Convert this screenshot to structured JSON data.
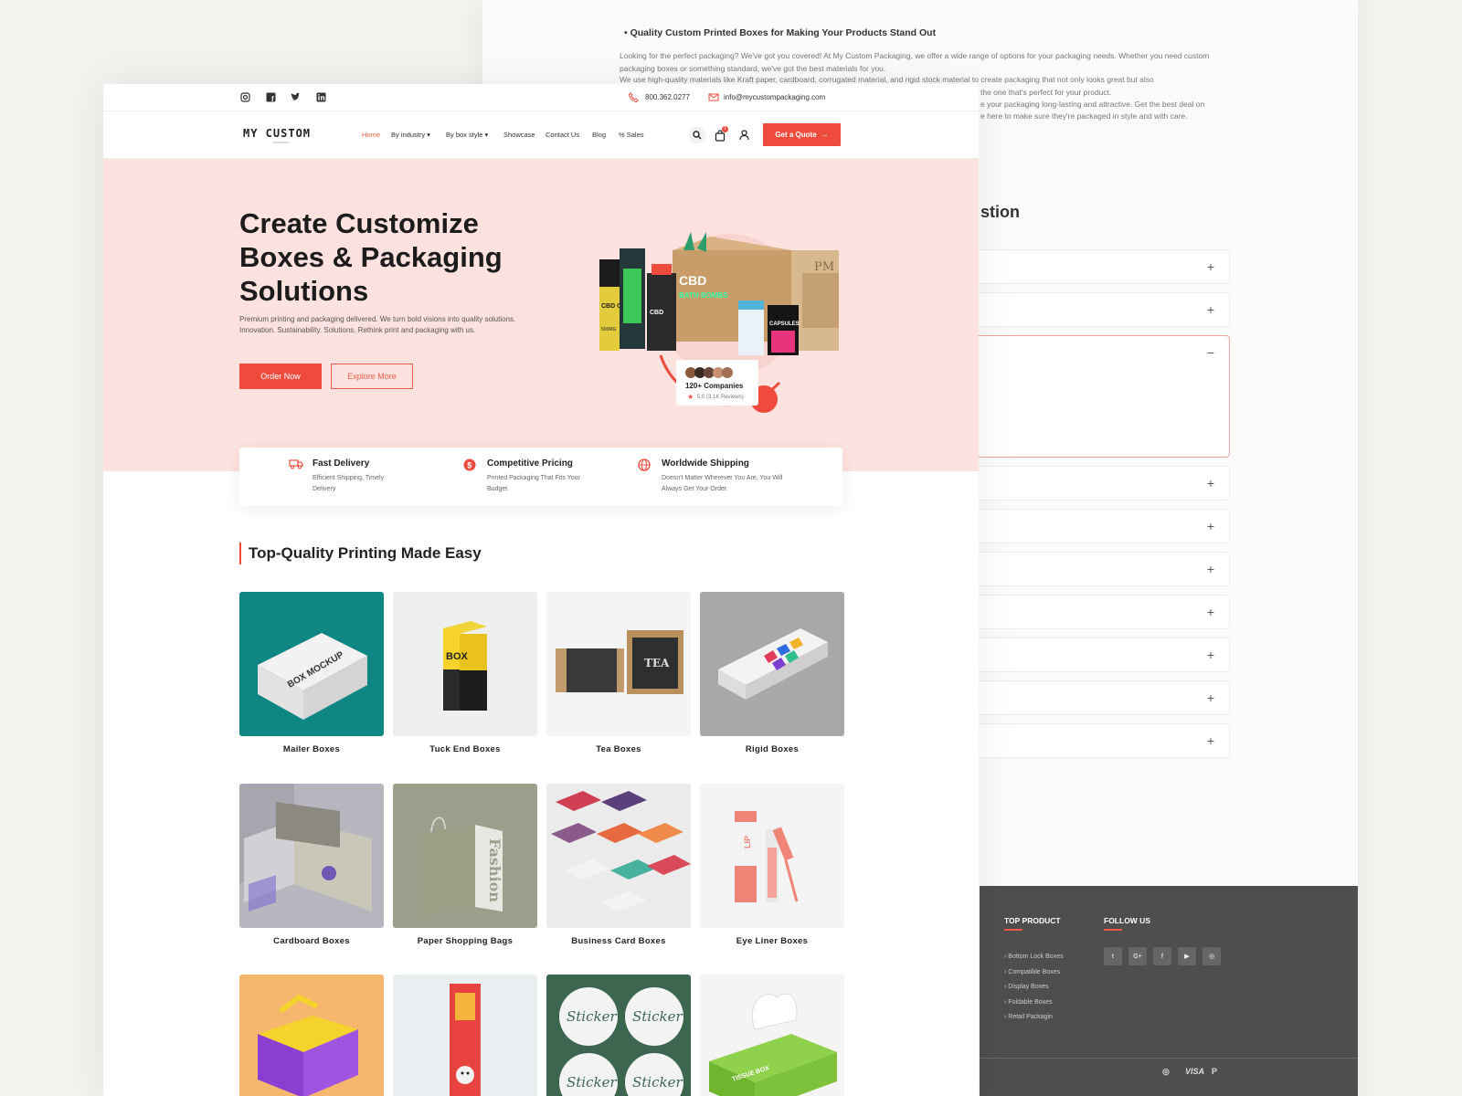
{
  "background_page": {
    "bullet": "Quality Custom Printed Boxes for Making Your Products Stand Out",
    "paragraph_1": "Looking for the perfect packaging? We've got you covered! At My Custom Packaging, we offer a wide range of options for your packaging needs. Whether you need custom packaging boxes or something standard, we've got the best materials for you.",
    "paragraph_2": "We use high-quality materials like Kraft paper, cardboard, corrugated material, and rigid stock material to create packaging that not only looks great but also",
    "paragraph_3": "the one that's perfect for your product.",
    "paragraph_4": "e your packaging long-lasting and attractive. Get the best deal on",
    "paragraph_5": "e here to make sure they're packaged in style and with care.",
    "faq_heading": "stion",
    "footer": {
      "top_product_heading": "TOP PRODUCT",
      "follow_heading": "FOLLOW US",
      "products": [
        "› Bottom Lock Boxes",
        "› Compatible Boxes",
        "› Display Boxes",
        "› Foldable Boxes",
        "› Retail Packagin"
      ],
      "social": [
        "t",
        "G+",
        "f",
        "▶",
        "◎"
      ],
      "payments": [
        "◎",
        "VISA",
        "P"
      ]
    }
  },
  "topbar": {
    "phone": "800.362.0277",
    "email": "info@mycustompackaging.com"
  },
  "nav": {
    "logo": "MY CUSTOM",
    "logo_sub": "PACKAGING",
    "items": [
      "Home",
      "By industry ▾",
      "By box style ▾",
      "Showcase",
      "Contact Us",
      "Blog",
      "% Sales"
    ],
    "cart_count": "1",
    "quote_label": "Get a Quote"
  },
  "hero": {
    "title": "Create Customize Boxes & Packaging Solutions",
    "subtitle": "Premium printing and packaging delivered. We turn bold visions into quality solutions. Innovation. Sustainability. Solutions. Rethink print and packaging with us.",
    "order_label": "Order Now",
    "explore_label": "Explore More",
    "companies": "120+ Companies",
    "rating": "5.0 (3.1K Reviews)",
    "pkg_texts": [
      "CBD",
      "BATH BOMBS",
      "CBD OIL",
      "CBD",
      "CAPSULES",
      "PM",
      "500MG"
    ]
  },
  "features": [
    {
      "title": "Fast Delivery",
      "desc": "Efficient Shipping, Timely Delivery"
    },
    {
      "title": "Competitive Pricing",
      "desc": "Printed Packaging That Fits Your Budget"
    },
    {
      "title": "Worldwide Shipping",
      "desc": "Doesn't Matter Wherever You Are, You Will Always Get Your Order."
    }
  ],
  "section_title": "Top-Quality Printing Made Easy",
  "products": [
    {
      "label": "Mailer Boxes"
    },
    {
      "label": "Tuck End Boxes"
    },
    {
      "label": "Tea Boxes"
    },
    {
      "label": "Rigid Boxes"
    },
    {
      "label": "Cardboard Boxes"
    },
    {
      "label": "Paper Shopping Bags"
    },
    {
      "label": "Business Card Boxes"
    },
    {
      "label": "Eye Liner Boxes"
    }
  ],
  "product_texts": {
    "mailer": "BOX MOCKUP",
    "tuck": "BOX",
    "tea": "TEA",
    "bag": "Fashion",
    "lip": "LIP",
    "sticker": "Sticker",
    "tissue": "TISSUE BOX"
  },
  "colors": {
    "accent": "#ef4b3c",
    "hero_bg": "#fde2df",
    "footer_bg": "#4e4e4e"
  }
}
